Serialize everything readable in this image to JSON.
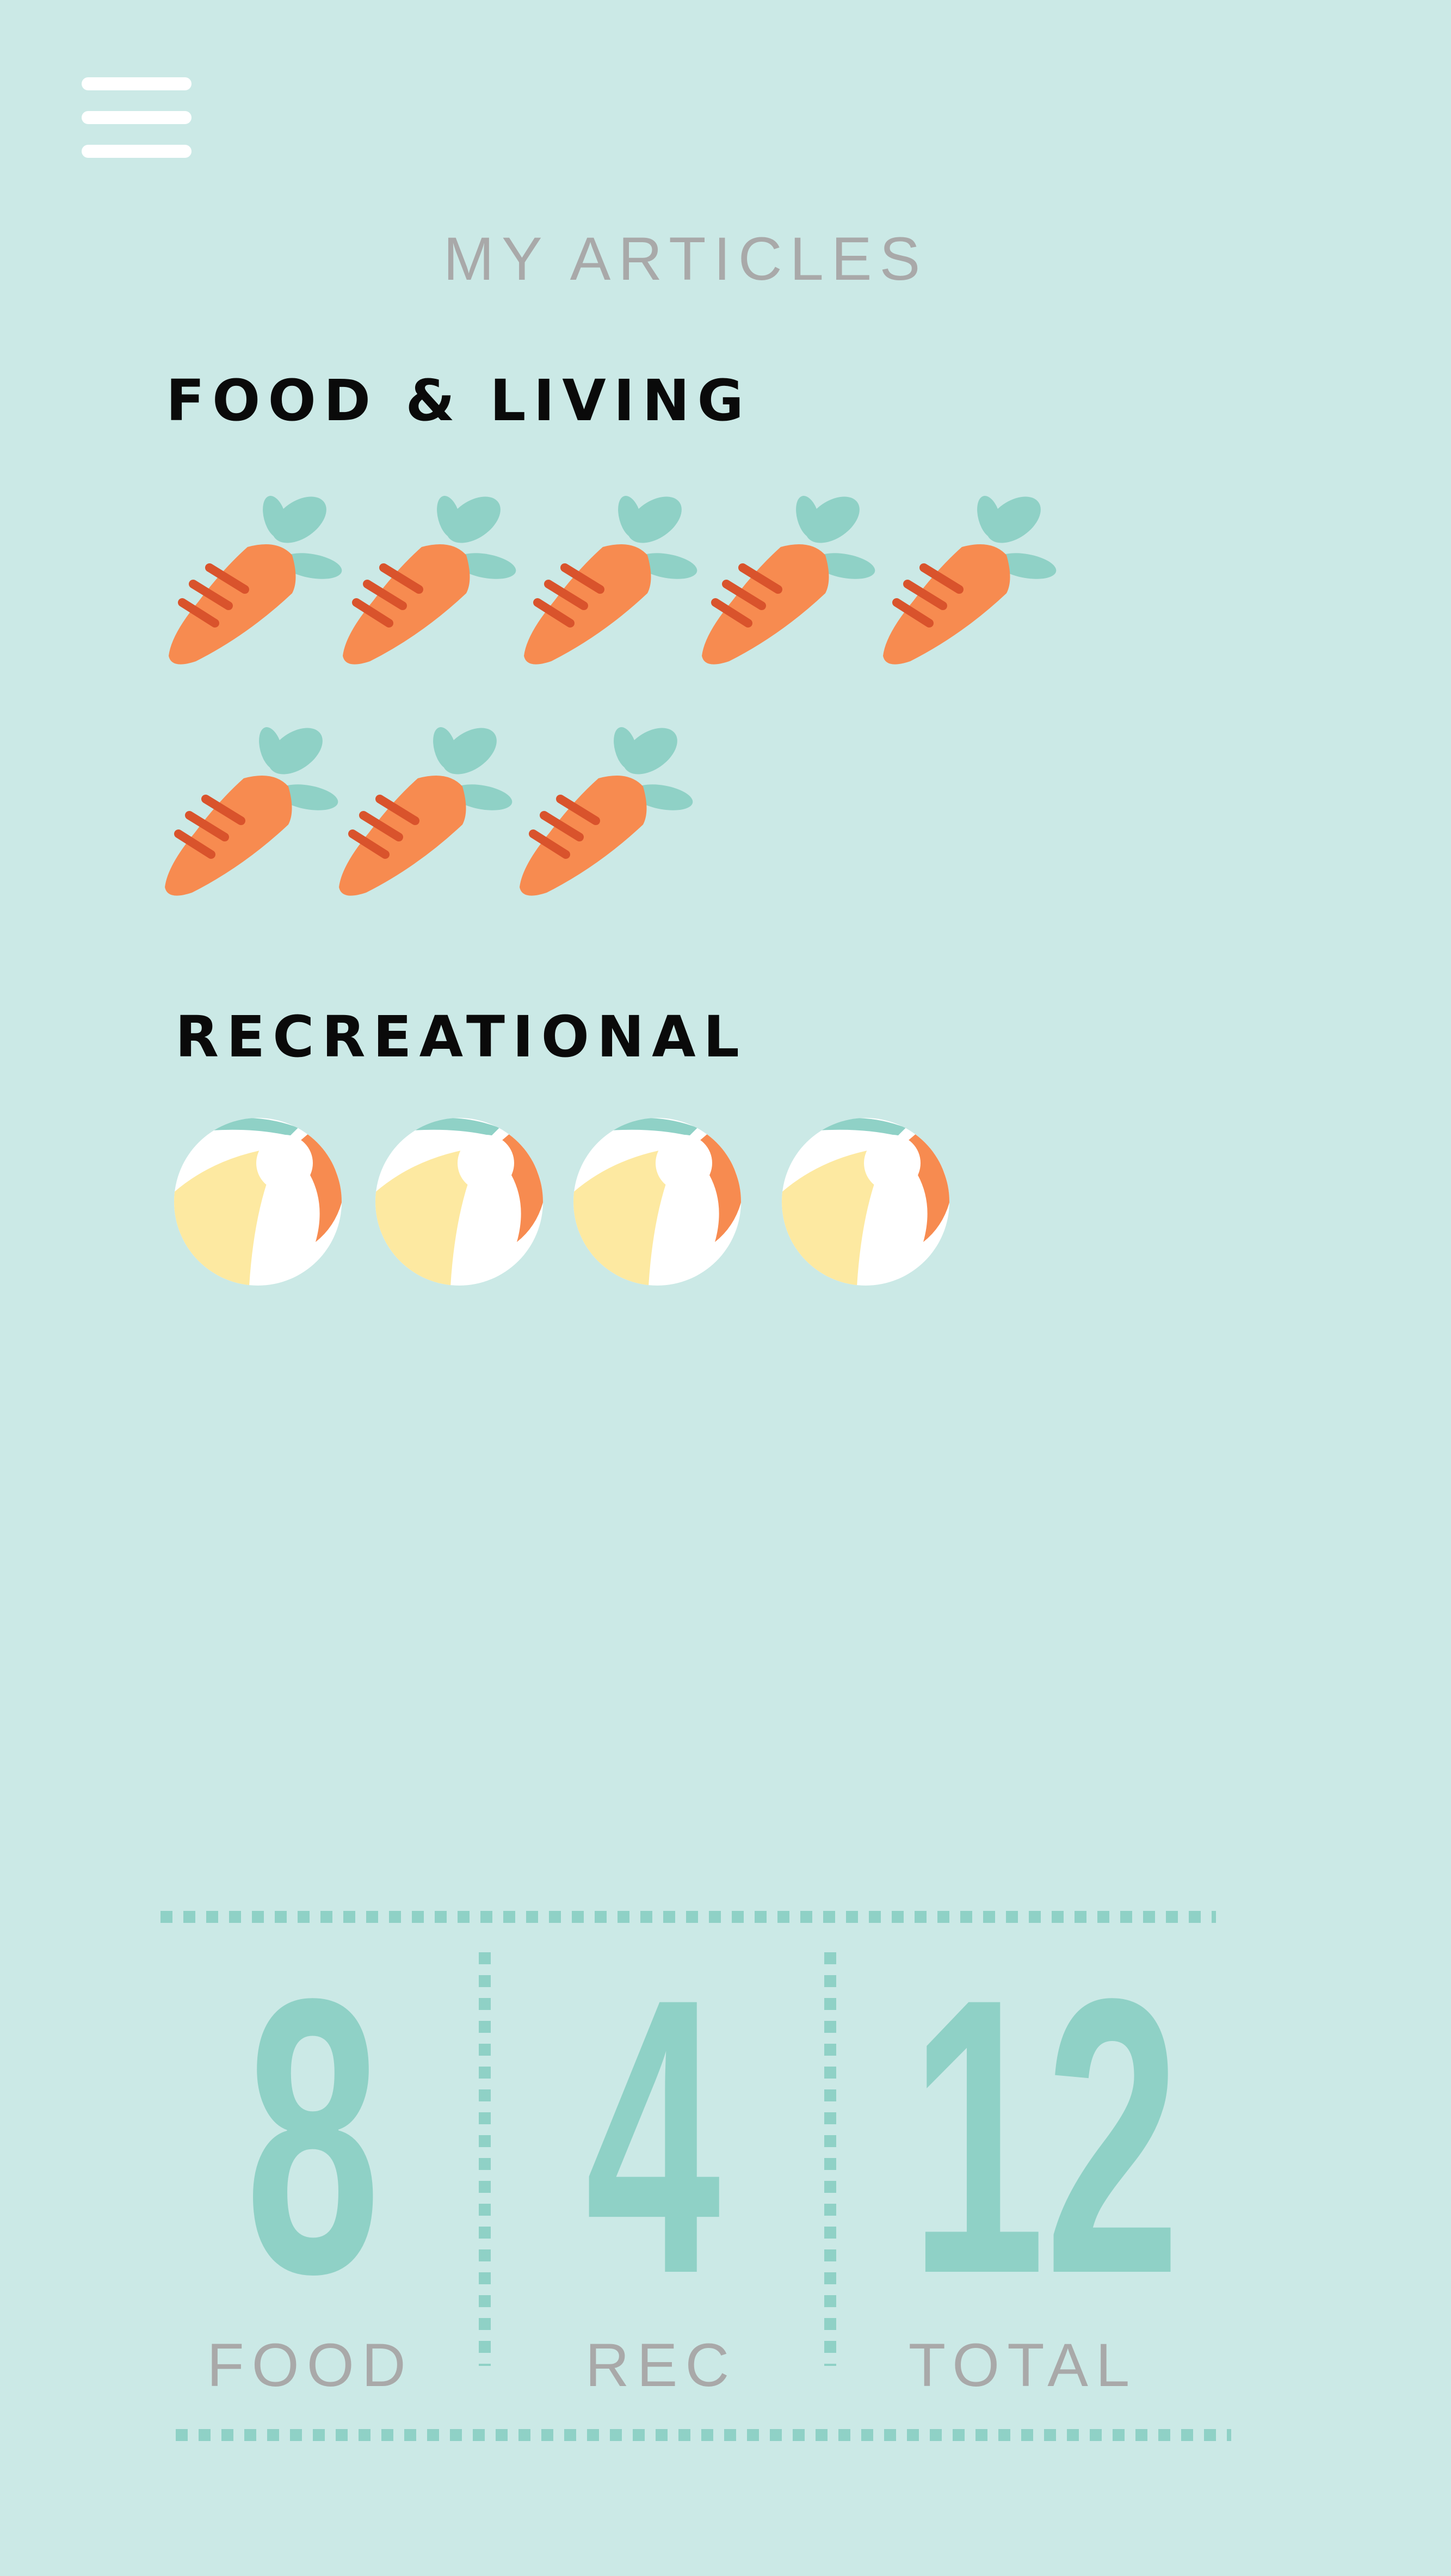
{
  "header": {
    "menu_icon": "hamburger-menu-icon",
    "title": "MY ARTICLES"
  },
  "sections": [
    {
      "title": "FOOD & LIVING",
      "icon": "carrot-icon",
      "count": 8
    },
    {
      "title": "RECREATIONAL",
      "icon": "beach-ball-icon",
      "count": 4
    }
  ],
  "stats": [
    {
      "value": "8",
      "label": "FOOD"
    },
    {
      "value": "4",
      "label": "REC"
    },
    {
      "value": "12",
      "label": "TOTAL"
    }
  ],
  "colors": {
    "background": "#cbe9e6",
    "accent": "#8fd1c6",
    "carrot": "#f78b50",
    "carrot_lines": "#d9532c",
    "ball_yellow": "#fde9a1",
    "muted_text": "#a9a9a9"
  }
}
